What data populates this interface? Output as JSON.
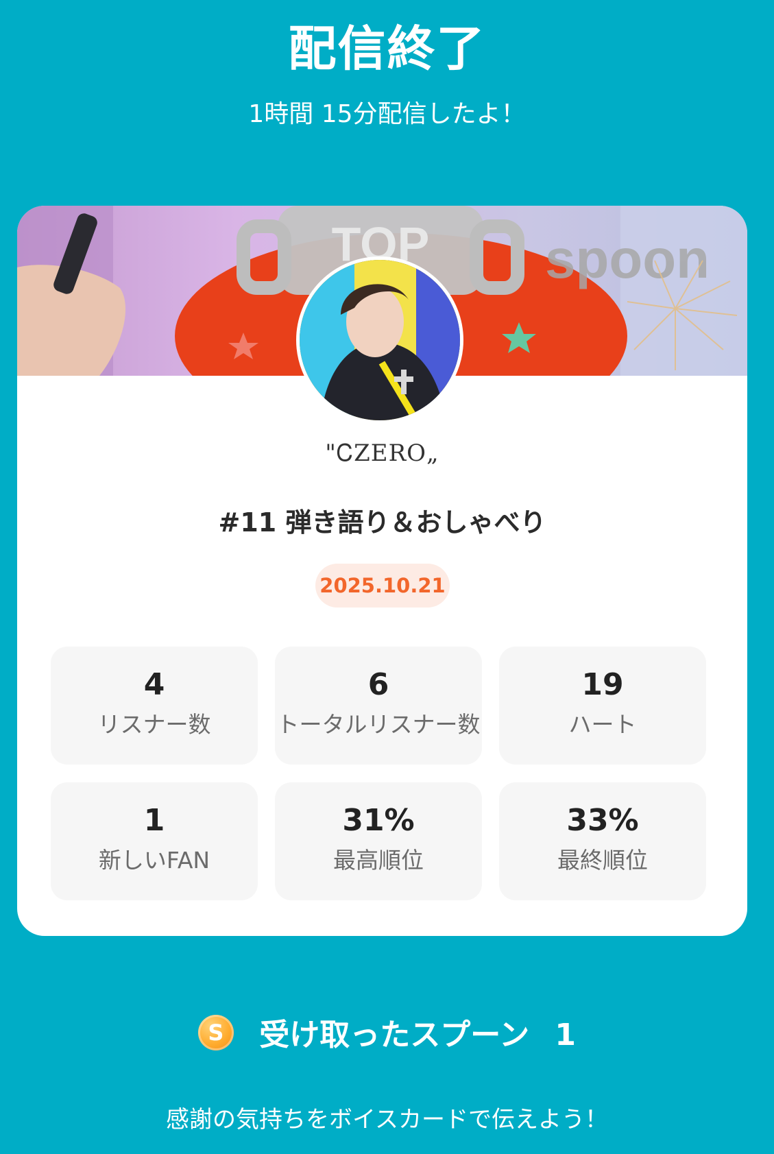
{
  "header": {
    "title": "配信終了",
    "subtitle": "1時間 15分配信したよ！"
  },
  "card": {
    "banner": {
      "badge_text": "TOP",
      "brand_text": "spoon"
    },
    "username": "\"ᏟZERO„",
    "stream_title": "#11 弾き語り＆おしゃべり",
    "date": "2025.10.21",
    "stats": [
      {
        "value": "4",
        "label": "リスナー数"
      },
      {
        "value": "6",
        "label": "トータルリスナー数"
      },
      {
        "value": "19",
        "label": "ハート"
      },
      {
        "value": "1",
        "label": "新しいFAN"
      },
      {
        "value": "31%",
        "label": "最高順位"
      },
      {
        "value": "33%",
        "label": "最終順位"
      }
    ]
  },
  "spoons": {
    "icon": "spoon-coin-icon",
    "coin_letter": "S",
    "label": "受け取ったスプーン",
    "count": "1"
  },
  "footer": {
    "message": "感謝の気持ちをボイスカードで伝えよう！"
  },
  "colors": {
    "background": "#00adc6",
    "card": "#ffffff",
    "stat_box": "#f6f6f6",
    "date_badge_bg": "#fdebe4",
    "date_badge_text": "#f2662b",
    "coin": "#ffac2f"
  }
}
